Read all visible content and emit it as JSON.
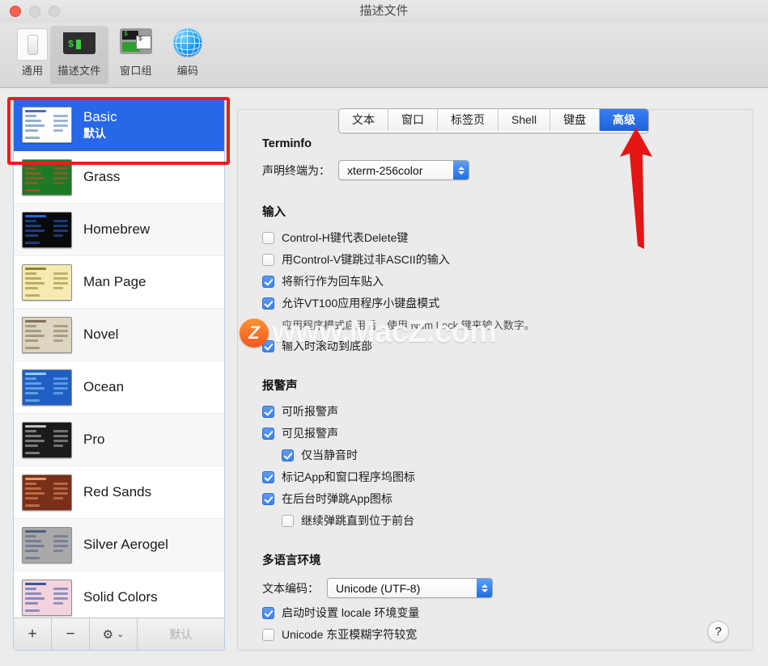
{
  "window": {
    "title": "描述文件",
    "traffic_lights": [
      "close",
      "minimize",
      "zoom"
    ]
  },
  "toolbar": {
    "items": [
      {
        "label": "通用",
        "icon": "general-switch-icon",
        "selected": false
      },
      {
        "label": "描述文件",
        "icon": "terminal-profiles-icon",
        "selected": true
      },
      {
        "label": "窗口组",
        "icon": "window-groups-icon",
        "selected": false
      },
      {
        "label": "编码",
        "icon": "globe-encoding-icon",
        "selected": false
      }
    ]
  },
  "sidebar": {
    "profiles": [
      {
        "name": "Basic",
        "subtitle": "默认",
        "selected": true,
        "thumb_bg": "#ffffff",
        "thumb_fg": "#3a6ea5"
      },
      {
        "name": "Grass",
        "subtitle": "",
        "selected": false,
        "thumb_bg": "#1c7a27",
        "thumb_fg": "#d84a28"
      },
      {
        "name": "Homebrew",
        "subtitle": "",
        "selected": false,
        "thumb_bg": "#0a0a0a",
        "thumb_fg": "#2b6ae0"
      },
      {
        "name": "Man Page",
        "subtitle": "",
        "selected": false,
        "thumb_bg": "#f5eab0",
        "thumb_fg": "#8a7a2e"
      },
      {
        "name": "Novel",
        "subtitle": "",
        "selected": false,
        "thumb_bg": "#ded5c0",
        "thumb_fg": "#7a6a50"
      },
      {
        "name": "Ocean",
        "subtitle": "",
        "selected": false,
        "thumb_bg": "#1f5fc4",
        "thumb_fg": "#9ed0ff"
      },
      {
        "name": "Pro",
        "subtitle": "",
        "selected": false,
        "thumb_bg": "#1a1a1a",
        "thumb_fg": "#c9c9c9"
      },
      {
        "name": "Red Sands",
        "subtitle": "",
        "selected": false,
        "thumb_bg": "#7a2f18",
        "thumb_fg": "#e8a070"
      },
      {
        "name": "Silver Aerogel",
        "subtitle": "",
        "selected": false,
        "thumb_bg": "#a9a9a9",
        "thumb_fg": "#4a5a80"
      },
      {
        "name": "Solid Colors",
        "subtitle": "",
        "selected": false,
        "thumb_bg": "#f3d4dd",
        "thumb_fg": "#2b4fa0"
      }
    ],
    "buttons": {
      "add": "+",
      "remove": "−",
      "gear": "⚙",
      "gear_chevron": "⌄",
      "default": "默认"
    }
  },
  "tabs": [
    {
      "label": "文本",
      "active": false
    },
    {
      "label": "窗口",
      "active": false
    },
    {
      "label": "标签页",
      "active": false
    },
    {
      "label": "Shell",
      "active": false
    },
    {
      "label": "键盘",
      "active": false
    },
    {
      "label": "高级",
      "active": true
    }
  ],
  "main": {
    "terminfo": {
      "title": "Terminfo",
      "declare_label": "声明终端为：",
      "declare_value": "xterm-256color"
    },
    "input": {
      "title": "输入",
      "options": [
        {
          "label": "Control-H键代表Delete键",
          "checked": false,
          "indent": false
        },
        {
          "label": "用Control-V键跳过非ASCII的输入",
          "checked": false,
          "indent": false
        },
        {
          "label": "将新行作为回车贴入",
          "checked": true,
          "indent": false
        },
        {
          "label": "允许VT100应用程序小键盘模式",
          "checked": true,
          "indent": false
        }
      ],
      "note": "应用程序模式启用后，使用 Num Lock 键来输入数字。",
      "options_after_note": [
        {
          "label": "输入时滚动到底部",
          "checked": true,
          "indent": false
        }
      ]
    },
    "bell": {
      "title": "报警声",
      "options": [
        {
          "label": "可听报警声",
          "checked": true,
          "indent": false
        },
        {
          "label": "可见报警声",
          "checked": true,
          "indent": false
        },
        {
          "label": "仅当静音时",
          "checked": true,
          "indent": true
        },
        {
          "label": "标记App和窗口程序坞图标",
          "checked": true,
          "indent": false
        },
        {
          "label": "在后台时弹跳App图标",
          "checked": true,
          "indent": false
        },
        {
          "label": "继续弹跳直到位于前台",
          "checked": false,
          "indent": true
        }
      ]
    },
    "international": {
      "title": "多语言环境",
      "encoding_label": "文本编码：",
      "encoding_value": "Unicode (UTF-8)",
      "options": [
        {
          "label": "启动时设置 locale 环境变量",
          "checked": true,
          "indent": false
        },
        {
          "label": "Unicode 东亚模糊字符较宽",
          "checked": false,
          "indent": false
        }
      ]
    },
    "help_button": "?"
  },
  "annotations": {
    "rect_color": "#ef1b1b",
    "arrow_color": "#e31515",
    "arrow_target": "高级"
  },
  "watermark": {
    "logo": "Z",
    "text": "www.MacZ.com"
  }
}
